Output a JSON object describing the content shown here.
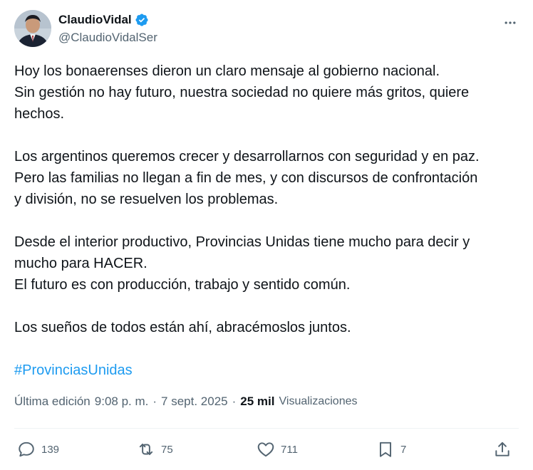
{
  "author": {
    "display_name": "ClaudioVidal",
    "handle": "@ClaudioVidalSer",
    "verified": true
  },
  "post": {
    "paragraphs": [
      [
        "Hoy los bonaerenses dieron un claro mensaje al gobierno nacional.",
        "Sin gestión no hay futuro, nuestra sociedad no quiere más gritos, quiere",
        "hechos."
      ],
      [
        "Los argentinos queremos crecer y desarrollarnos con seguridad y en paz.",
        "Pero las familias no llegan a fin de mes, y con discursos de confrontación",
        "y división, no se resuelven los problemas."
      ],
      [
        "Desde el interior productivo, Provincias Unidas tiene mucho para decir y",
        "mucho para HACER.",
        "El futuro es con producción, trabajo y sentido común."
      ],
      [
        "Los sueños de todos están ahí, abracémoslos juntos."
      ]
    ],
    "hashtag": "#ProvinciasUnidas"
  },
  "meta": {
    "edited_prefix": "Última edición",
    "time": "9:08 p. m.",
    "date": "7 sept. 2025",
    "separator": "·",
    "views_count": "25 mil",
    "views_label": "Visualizaciones"
  },
  "actions": {
    "replies": "139",
    "reposts": "75",
    "likes": "711",
    "bookmarks": "7"
  },
  "colors": {
    "accent": "#1d9bf0",
    "text": "#0f1419",
    "secondary": "#536471"
  }
}
